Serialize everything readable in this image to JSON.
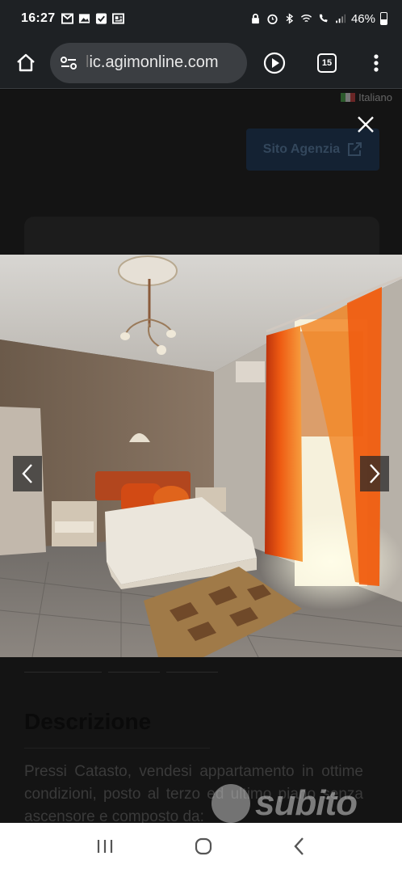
{
  "status_bar": {
    "time": "16:27",
    "battery": "46%"
  },
  "browser": {
    "url_faded": "l",
    "url": "ic.agimonline.com",
    "tab_count": "15"
  },
  "page": {
    "language": "Italiano",
    "agency_button": "Sito Agenzia",
    "description_title": "Descrizione",
    "description_text": "Pressi Catasto, vendesi appartamento in ottime condizioni, posto al terzo ed ultimo piano senza ascensore e composto da:",
    "watermark": "subito"
  },
  "colors": {
    "agency_button_bg": "#142233",
    "overlay": "#141414",
    "nav_bar": "#ffffff"
  }
}
